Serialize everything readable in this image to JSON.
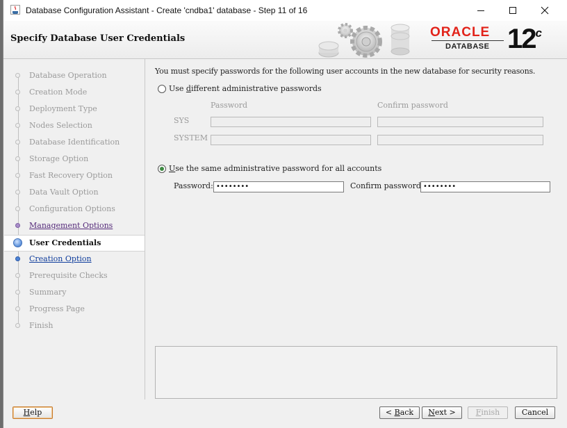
{
  "window": {
    "title": "Database Configuration Assistant - Create 'cndba1' database - Step 11 of 16"
  },
  "header": {
    "page_title": "Specify Database User Credentials",
    "logo": {
      "brand": "ORACLE",
      "product": "DATABASE",
      "version": "12",
      "version_suffix": "c",
      "brand_color": "#e2231a"
    }
  },
  "nav": {
    "items": [
      {
        "label": "Database Operation",
        "state": "done"
      },
      {
        "label": "Creation Mode",
        "state": "done"
      },
      {
        "label": "Deployment Type",
        "state": "done"
      },
      {
        "label": "Nodes Selection",
        "state": "done"
      },
      {
        "label": "Database Identification",
        "state": "done"
      },
      {
        "label": "Storage Option",
        "state": "done"
      },
      {
        "label": "Fast Recovery Option",
        "state": "done"
      },
      {
        "label": "Data Vault Option",
        "state": "done"
      },
      {
        "label": "Configuration Options",
        "state": "done"
      },
      {
        "label": "Management Options",
        "state": "visited"
      },
      {
        "label": "User Credentials",
        "state": "current"
      },
      {
        "label": "Creation Option",
        "state": "next"
      },
      {
        "label": "Prerequisite Checks",
        "state": "pending"
      },
      {
        "label": "Summary",
        "state": "pending"
      },
      {
        "label": "Progress Page",
        "state": "pending"
      },
      {
        "label": "Finish",
        "state": "pending"
      }
    ]
  },
  "main": {
    "intro": "You must specify passwords for the following user accounts in the new database for security reasons.",
    "option_different": {
      "prefix": "Use ",
      "mnemonic": "d",
      "rest": "ifferent administrative passwords",
      "selected": false
    },
    "table": {
      "col_password": "Password",
      "col_confirm": "Confirm password",
      "rows": [
        {
          "user": "SYS",
          "password": "",
          "confirm": ""
        },
        {
          "user": "SYSTEM",
          "password": "",
          "confirm": ""
        }
      ]
    },
    "option_same": {
      "mnemonic": "U",
      "rest": "se the same administrative password for all accounts",
      "selected": true
    },
    "password_label": "Password:",
    "password_value": "••••••••",
    "confirm_label": "Confirm password:",
    "confirm_value": "••••••••"
  },
  "buttons": {
    "help": {
      "mnemonic": "H",
      "rest": "elp"
    },
    "back": {
      "prefix": "< ",
      "mnemonic": "B",
      "rest": "ack"
    },
    "next": {
      "mnemonic": "N",
      "rest": "ext >"
    },
    "finish": {
      "mnemonic": "F",
      "rest": "inish"
    },
    "cancel": {
      "label": "Cancel"
    }
  }
}
